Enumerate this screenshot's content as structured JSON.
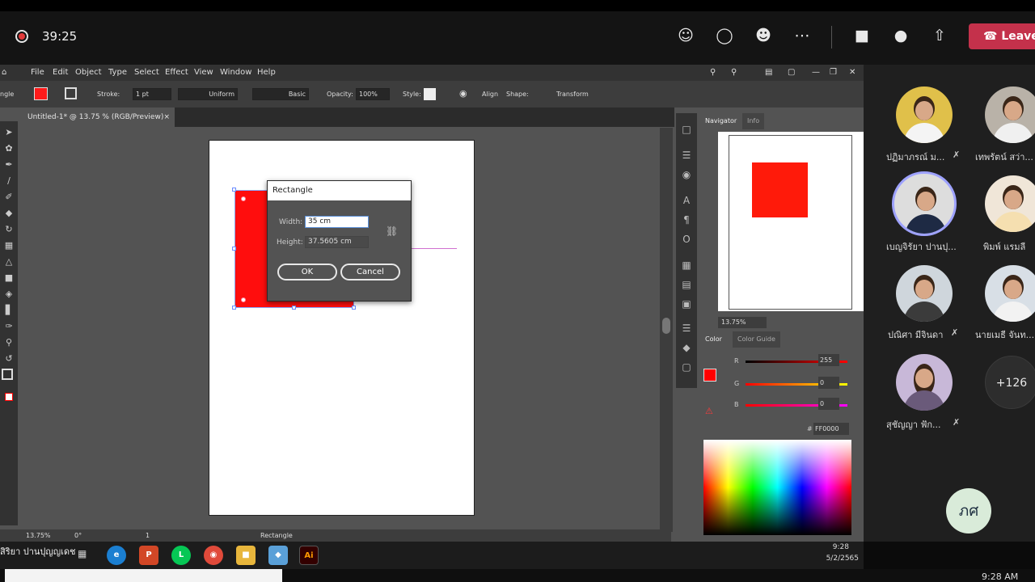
{
  "meeting": {
    "timer": "39:25",
    "leave_label": "Leave"
  },
  "menu": [
    "File",
    "Edit",
    "Object",
    "Type",
    "Select",
    "Effect",
    "View",
    "Window",
    "Help"
  ],
  "controlbar": {
    "left_cut": "ngle",
    "stroke_label": "Stroke:",
    "stroke_weight": "1 pt",
    "profile": "Uniform",
    "brush": "Basic",
    "opacity_label": "Opacity:",
    "opacity": "100%",
    "style_label": "Style:",
    "align": "Align",
    "shape": "Shape:",
    "transform": "Transform"
  },
  "document": {
    "tab_title": "Untitled-1* @ 13.75 % (RGB/Preview)",
    "close": "×"
  },
  "dialog": {
    "title": "Rectangle",
    "width_label": "Width:",
    "width_value": "35 cm",
    "height_label": "Height:",
    "height_value": "37.5605 cm",
    "ok": "OK",
    "cancel": "Cancel"
  },
  "navigator": {
    "tab_navigator": "Navigator",
    "tab_info": "Info",
    "zoom": "13.75%"
  },
  "color": {
    "tab_color": "Color",
    "tab_guide": "Color Guide",
    "r_label": "R",
    "r": "255",
    "g_label": "G",
    "g": "0",
    "b_label": "B",
    "b": "0",
    "hex": "FF0000"
  },
  "ai_status": {
    "zoom": "13.75%",
    "rotation": "0°",
    "artboard": "1",
    "tool": "Rectangle"
  },
  "participants": [
    {
      "name": "ปฏิมาภรณ์ ม..."
    },
    {
      "name": "เทพรัตน์ สว่า..."
    },
    {
      "name": "เบญจิรัยา ปานปุ..."
    },
    {
      "name": "พิมพ์ แรมลี"
    },
    {
      "name": "ปณิศา มีจินดา"
    },
    {
      "name": "นายเมธี จันท..."
    },
    {
      "name": "สุชัญญา ฟัก..."
    }
  ],
  "more_count": "+126",
  "self_initials": "ภศ",
  "taskbar": {
    "user_cut": "สิริยา ปานปุญญเดช",
    "time": "9:28",
    "date": "5/2/2565"
  },
  "bottom_clock": "9:28 AM",
  "colors": {
    "accent_red": "#ff0000",
    "leave": "#c4314b"
  }
}
